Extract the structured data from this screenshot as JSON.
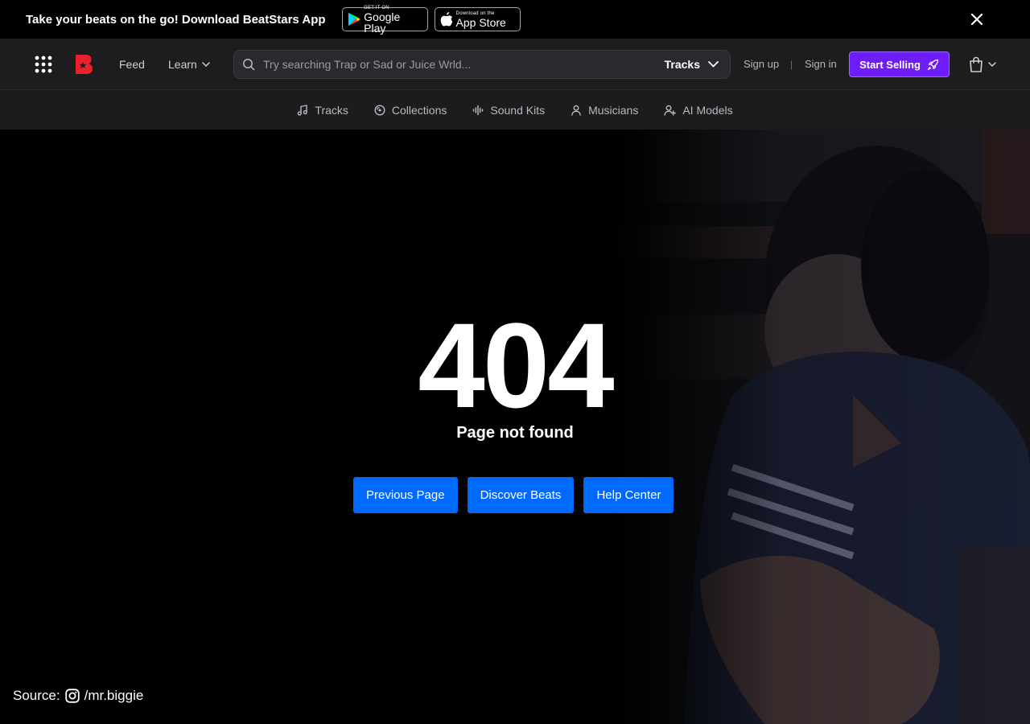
{
  "promo": {
    "text": "Take your beats on the go! Download BeatStars App",
    "google_play_small": "GET IT ON",
    "google_play_big": "Google Play",
    "app_store_small": "Download on the",
    "app_store_big": "App Store"
  },
  "header": {
    "nav": {
      "feed": "Feed",
      "learn": "Learn"
    },
    "search": {
      "placeholder": "Try searching Trap or Sad or Juice Wrld...",
      "type": "Tracks"
    },
    "auth": {
      "signup": "Sign up",
      "separator": "|",
      "signin": "Sign in"
    },
    "cta": "Start Selling"
  },
  "categories": [
    {
      "label": "Tracks",
      "icon": "music-note-icon"
    },
    {
      "label": "Collections",
      "icon": "disc-icon"
    },
    {
      "label": "Sound Kits",
      "icon": "waveform-icon"
    },
    {
      "label": "Musicians",
      "icon": "user-icon"
    },
    {
      "label": "AI Models",
      "icon": "user-plus-icon"
    }
  ],
  "hero": {
    "code": "404",
    "message": "Page not found",
    "buttons": [
      "Previous Page",
      "Discover Beats",
      "Help Center"
    ],
    "credit_prefix": "Source:",
    "credit_handle": "/mr.biggie"
  },
  "colors": {
    "accent_blue": "#006aff",
    "cta_purple": "#6e1cf9",
    "logo_red": "#e8212d",
    "header_bg": "#1d1d1f"
  }
}
